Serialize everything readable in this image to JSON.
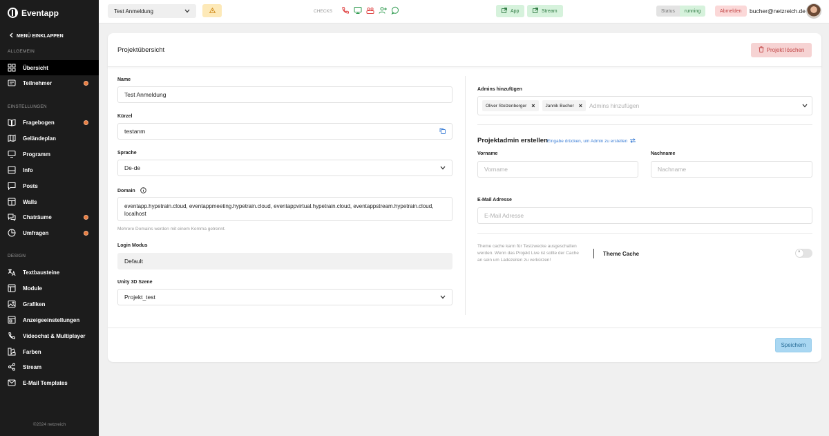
{
  "app": {
    "name": "Eventapp",
    "copyright": "©2024 netzreich"
  },
  "sidebar": {
    "collapse_label": "MENÜ EINKLAPPEN",
    "sections": {
      "allgemein": "ALLGEMEIN",
      "einstellungen": "EINSTELLUNGEN",
      "design": "DESIGN"
    },
    "items": [
      {
        "label": "Übersicht",
        "icon": "grid-icon",
        "active": true,
        "badge": false
      },
      {
        "label": "Teilnehmer",
        "icon": "users-icon",
        "active": false,
        "badge": true
      },
      {
        "label": "Fragebogen",
        "icon": "book-icon",
        "active": false,
        "badge": true
      },
      {
        "label": "Geländeplan",
        "icon": "map-icon",
        "active": false,
        "badge": false
      },
      {
        "label": "Programm",
        "icon": "monitor-icon",
        "active": false,
        "badge": false
      },
      {
        "label": "Info",
        "icon": "info-box-icon",
        "active": false,
        "badge": false
      },
      {
        "label": "Posts",
        "icon": "message-icon",
        "active": false,
        "badge": false
      },
      {
        "label": "Walls",
        "icon": "wall-icon",
        "active": false,
        "badge": false
      },
      {
        "label": "Chaträume",
        "icon": "chat-icon",
        "active": false,
        "badge": true
      },
      {
        "label": "Umfragen",
        "icon": "poll-icon",
        "active": false,
        "badge": true
      },
      {
        "label": "Textbausteine",
        "icon": "translate-icon",
        "active": false,
        "badge": false
      },
      {
        "label": "Module",
        "icon": "module-icon",
        "active": false,
        "badge": false
      },
      {
        "label": "Grafiken",
        "icon": "image-icon",
        "active": false,
        "badge": false
      },
      {
        "label": "Anzeigeeinstellungen",
        "icon": "display-settings-icon",
        "active": false,
        "badge": false
      },
      {
        "label": "Videochat & Multiplayer",
        "icon": "phone-icon",
        "active": false,
        "badge": false
      },
      {
        "label": "Farben",
        "icon": "palette-icon",
        "active": false,
        "badge": false
      },
      {
        "label": "Stream",
        "icon": "share-icon",
        "active": false,
        "badge": false
      },
      {
        "label": "E-Mail Templates",
        "icon": "mail-icon",
        "active": false,
        "badge": false
      }
    ]
  },
  "topbar": {
    "project_select": "Test Anmeldung",
    "checks_label": "CHECKS",
    "app_button": "App",
    "stream_button": "Stream",
    "status_label": "Status",
    "status_value": "running",
    "logout_label": "Abmelden",
    "user_email": "bucher@netzreich.de"
  },
  "card": {
    "title": "Projektübersicht",
    "delete_button": "Projekt löschen",
    "name_label": "Name",
    "name_value": "Test Anmeldung",
    "short_label": "Kürzel",
    "short_value": "testanm",
    "language_label": "Sprache",
    "language_value": "De-de",
    "domain_label": "Domain",
    "domain_value": "eventapp.hypetrain.cloud, eventappmeeting.hypetrain.cloud, eventappvirtual.hypetrain.cloud, eventappstream.hypetrain.cloud, localhost",
    "domain_hint": "Mehrere Domains werden mit einem Komma getrennt.",
    "login_label": "Login Modus",
    "login_value": "Default",
    "unity_label": "Unity 3D Szene",
    "unity_value": "Projekt_test",
    "admins_label": "Admins hinzufügen",
    "admins": [
      "Oliver Stolzenberger",
      "Jannik Bucher"
    ],
    "admins_placeholder": "Admins hinzufügen",
    "create_admin_title": "Projektadmin erstellen",
    "create_admin_hint": "Eingabe drücken, um Admin zu erstellen",
    "firstname_label": "Vorname",
    "firstname_placeholder": "Vorname",
    "lastname_label": "Nachname",
    "lastname_placeholder": "Nachname",
    "email_label": "E-Mail Adresse",
    "email_placeholder": "E-Mail Adresse",
    "theme_hint": "Theme cache kann für Testzwecke ausgeschalten werden. Wenn das Projekt Live ist sollte der Cache an sein um Ladezeiten zu verkürzen!",
    "theme_label": "Theme Cache",
    "theme_toggle_text": "×",
    "save_button": "Speichern"
  },
  "colors": {
    "sidebar_bg": "#1c1c1c",
    "badge": "#e87b3e",
    "green_pill": "#d6f2dc",
    "red_pill": "#fbd8d8",
    "save": "#a9d7f2",
    "link": "#3d7fd6"
  }
}
